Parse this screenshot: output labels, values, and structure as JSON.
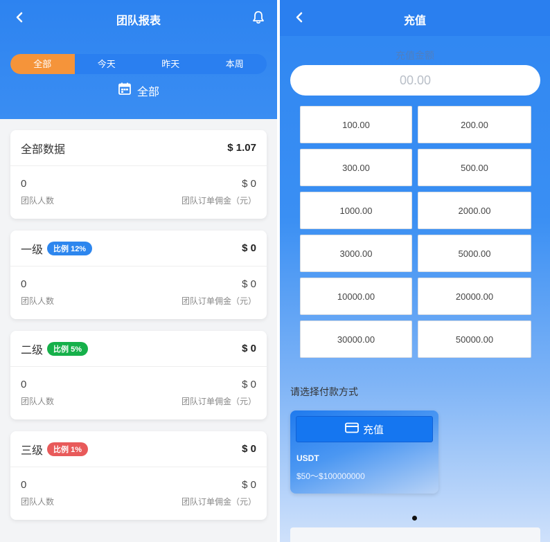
{
  "left": {
    "header": {
      "title": "团队报表"
    },
    "tabs": [
      {
        "label": "全部",
        "active": true
      },
      {
        "label": "今天",
        "active": false
      },
      {
        "label": "昨天",
        "active": false
      },
      {
        "label": "本周",
        "active": false
      }
    ],
    "date_filter": {
      "label": "全部"
    },
    "cards": [
      {
        "title": "全部数据",
        "amount": "$ 1.07",
        "badge": null,
        "members": "0",
        "members_label": "团队人数",
        "commission": "$ 0",
        "commission_label": "团队订单佣金（元）"
      },
      {
        "title": "一级",
        "amount": "$ 0",
        "badge": "比例 12%",
        "badge_color": "#2d86ee",
        "members": "0",
        "members_label": "团队人数",
        "commission": "$ 0",
        "commission_label": "团队订单佣金（元）"
      },
      {
        "title": "二级",
        "amount": "$ 0",
        "badge": "比例 5%",
        "badge_color": "#16b04a",
        "members": "0",
        "members_label": "团队人数",
        "commission": "$ 0",
        "commission_label": "团队订单佣金（元）"
      },
      {
        "title": "三级",
        "amount": "$ 0",
        "badge": "比例 1%",
        "badge_color": "#e85a5a",
        "members": "0",
        "members_label": "团队人数",
        "commission": "$ 0",
        "commission_label": "团队订单佣金（元）"
      }
    ]
  },
  "right": {
    "header": {
      "title": "充值"
    },
    "amount_label": "充值金额",
    "amount_placeholder": "00.00",
    "amounts": [
      "100.00",
      "200.00",
      "300.00",
      "500.00",
      "1000.00",
      "2000.00",
      "3000.00",
      "5000.00",
      "10000.00",
      "20000.00",
      "30000.00",
      "50000.00"
    ],
    "payment_title": "请选择付款方式",
    "payment": {
      "button_label": "充值",
      "name": "USDT",
      "range": "$50～$100000000"
    }
  },
  "colors": {
    "primary": "#2d83f0",
    "active_tab": "#f5943a"
  }
}
